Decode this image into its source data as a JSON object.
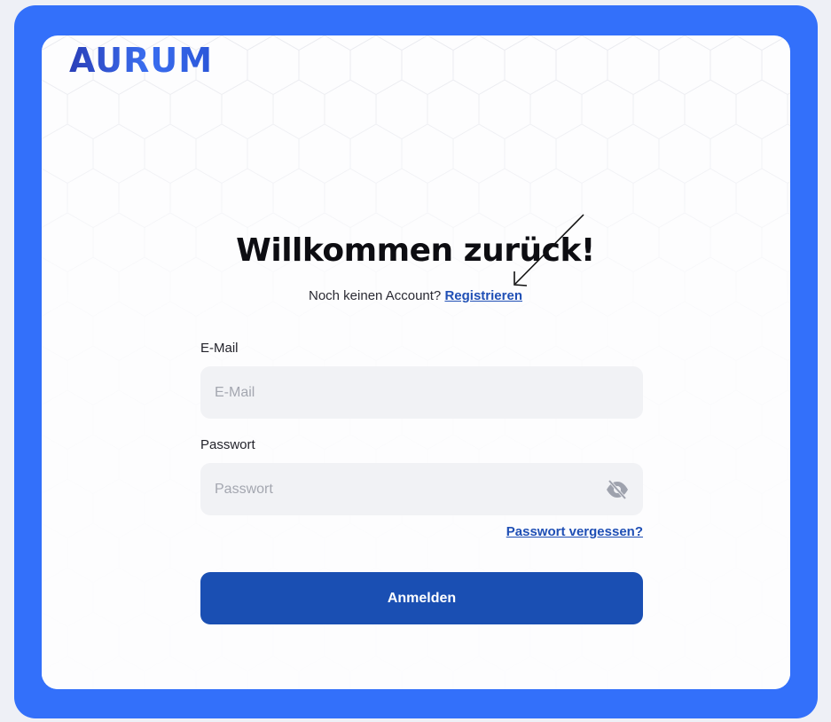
{
  "brand": {
    "name": "AURUM",
    "accent_color": "#3370fa",
    "primary_button_color": "#1a4fb3",
    "link_color": "#1f4fb5"
  },
  "heading": "Willkommen zurück!",
  "signup": {
    "prompt": "Noch keinen Account?",
    "link_label": "Registrieren"
  },
  "form": {
    "email": {
      "label": "E-Mail",
      "placeholder": "E-Mail",
      "value": ""
    },
    "password": {
      "label": "Passwort",
      "placeholder": "Passwort",
      "value": "",
      "toggle_icon": "eye-off-icon"
    },
    "forgot_label": "Passwort vergessen?",
    "submit_label": "Anmelden"
  }
}
